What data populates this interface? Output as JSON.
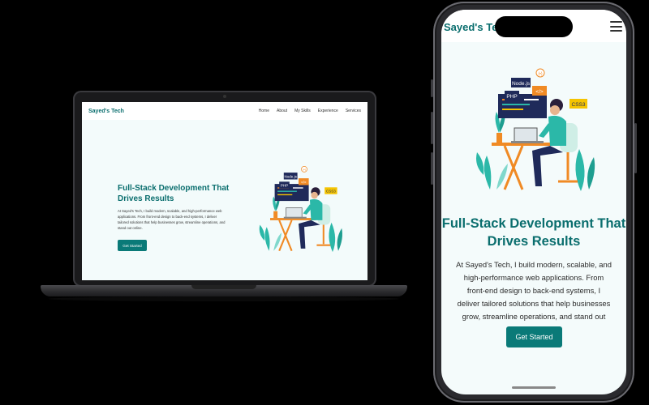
{
  "site": {
    "brand": "Sayed's Tech",
    "nav": [
      "Home",
      "About",
      "My Skills",
      "Experience",
      "Services"
    ],
    "hero": {
      "title": "Full-Stack Development That Drives Results",
      "description": "At Sayed's Tech, I build modern, scalable, and high-performance web applications. From front-end design to back-end systems, I deliver tailored solutions that help businesses grow, streamline operations, and stand out online.",
      "cta": "Get Started"
    },
    "illustration_tags": [
      "Node.js",
      "PHP",
      "</>",
      "CSS3",
      "(•)"
    ]
  },
  "colors": {
    "brand": "#0a6e6e",
    "button": "#0a7a78",
    "hero_bg": "#f3fbfb",
    "illustration_accent": "#2bb8a8",
    "illustration_orange": "#f08a24",
    "illustration_yellow": "#f5c400",
    "illustration_navy": "#1f2a5a"
  },
  "icons": {
    "menu": "hamburger-menu-icon"
  }
}
